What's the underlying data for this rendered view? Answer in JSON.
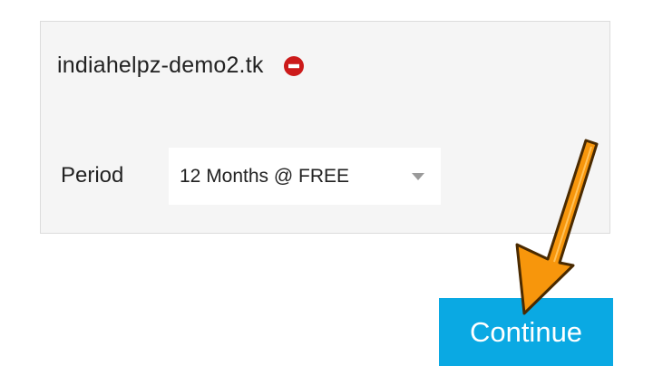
{
  "domain_card": {
    "domain_name": "indiahelpz-demo2.tk",
    "remove_icon": "minus-circle-icon",
    "remove_icon_color": "#cc1a1a"
  },
  "period": {
    "label": "Period",
    "selected_value": "12 Months @ FREE"
  },
  "actions": {
    "continue_label": "Continue",
    "continue_color": "#0aa9e3"
  },
  "annotation": {
    "arrow_color": "#f7960c"
  }
}
